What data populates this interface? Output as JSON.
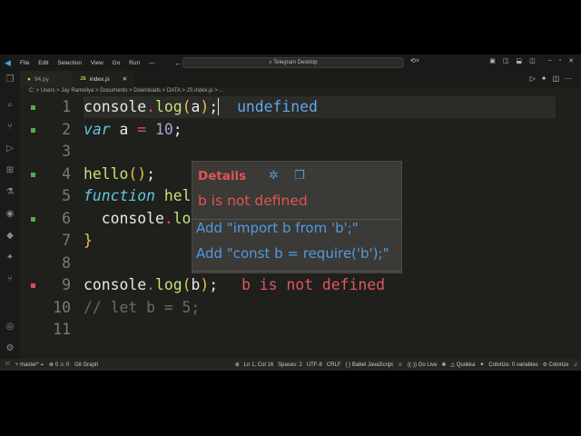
{
  "menu": [
    "File",
    "Edit",
    "Selection",
    "View",
    "Go",
    "Run"
  ],
  "search": {
    "placeholder": "Telegram Desktop"
  },
  "tabs": [
    {
      "label": "94.py",
      "active": false
    },
    {
      "label": "index.js",
      "active": true,
      "badge": "JS"
    }
  ],
  "breadcrumb": "C: > Users > Jay Ramoliya > Documents > Downloads > DATA > JS index.js > ...",
  "code": [
    {
      "n": "1",
      "marker": "green"
    },
    {
      "n": "2",
      "marker": "green"
    },
    {
      "n": "3",
      "marker": ""
    },
    {
      "n": "4",
      "marker": "green"
    },
    {
      "n": "5",
      "marker": ""
    },
    {
      "n": "6",
      "marker": "green"
    },
    {
      "n": "7",
      "marker": ""
    },
    {
      "n": "8",
      "marker": ""
    },
    {
      "n": "9",
      "marker": "red"
    },
    {
      "n": "10",
      "marker": ""
    },
    {
      "n": "11",
      "marker": ""
    }
  ],
  "inline": {
    "line1": "undefined",
    "line9": "b is not defined"
  },
  "hover": {
    "title": "Details",
    "message": "b is not defined",
    "fixes": [
      "Add \"import b from 'b';\"",
      "Add \"const b = require('b');\""
    ]
  },
  "status": {
    "branch": "master*",
    "errors": "0",
    "warnings": "0",
    "git_graph": "Git Graph",
    "position": "Ln 1, Col 16",
    "spaces": "Spaces: 2",
    "encoding": "UTF-8",
    "eol": "CRLF",
    "language": "Babel JavaScript",
    "go_live": "Go Live",
    "quokka": "Quokka",
    "colorize_vars": "Colorize: 0 variables",
    "colorize": "Colorize"
  },
  "colors": {
    "accent": "#4f9be0",
    "error": "#e05555"
  }
}
